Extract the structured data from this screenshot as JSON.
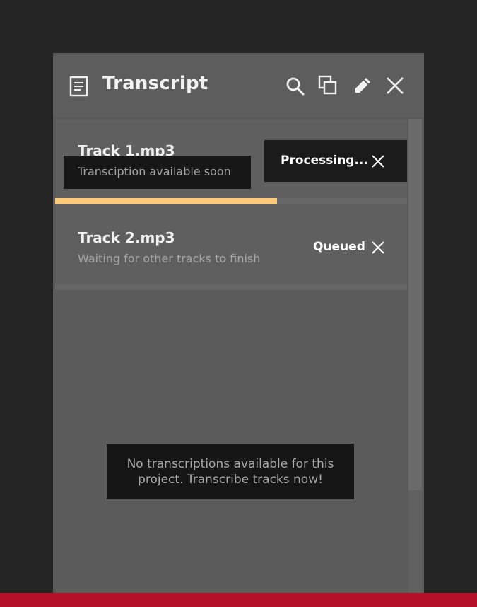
{
  "header": {
    "title": "Transcript",
    "icons": [
      "document-icon",
      "search-icon",
      "copy-icon",
      "edit-icon",
      "close-icon"
    ]
  },
  "tracks": [
    {
      "name": "Track 1.mp3",
      "subtitle": "Transciption available soon",
      "status": "Processing...",
      "progress": 0.63
    },
    {
      "name": "Track 2.mp3",
      "subtitle": "Waiting for other tracks to finish",
      "status": "Queued"
    }
  ],
  "empty_state": {
    "message": "No transcriptions available for this project. Transcribe tracks now!"
  },
  "colors": {
    "background": "#242424",
    "panel": "#5b5b5b",
    "progress": "#ffc97a",
    "accent_bar": "#b3112a"
  }
}
